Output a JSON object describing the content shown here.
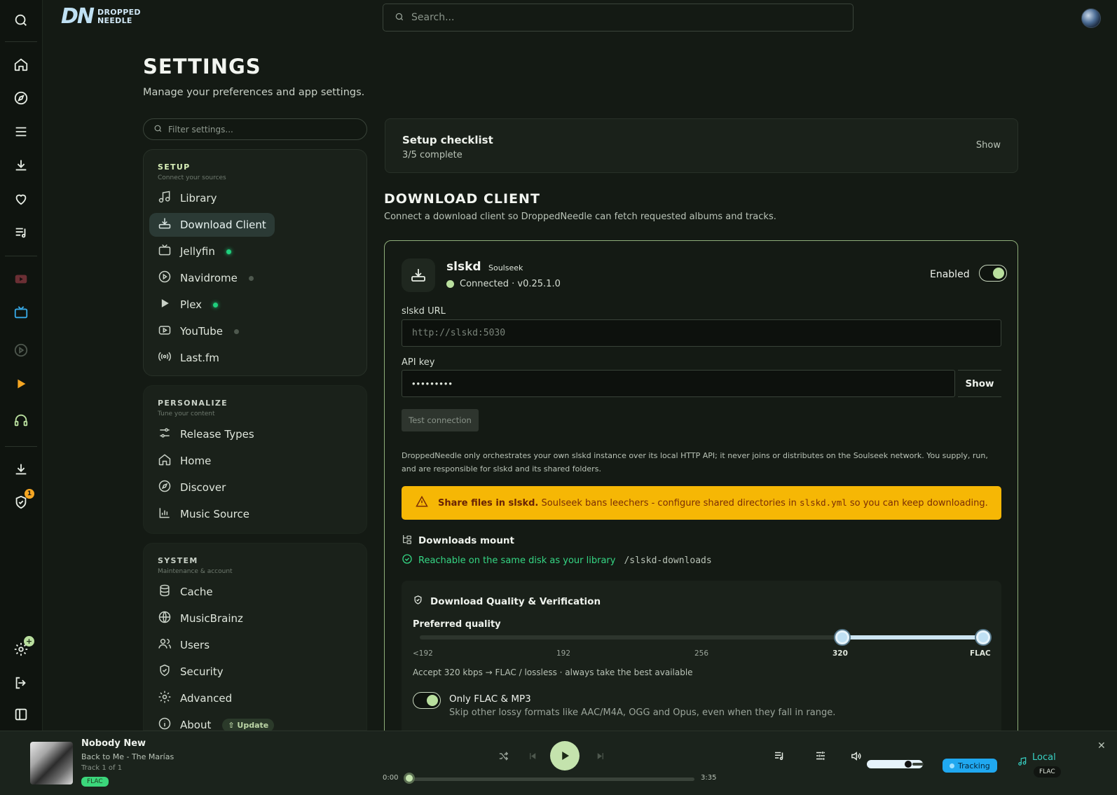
{
  "app": {
    "brand_mark": "DN",
    "brand_line1": "DROPPED",
    "brand_line2": "NEEDLE",
    "search_placeholder": "Search..."
  },
  "rail": {
    "icons": [
      "search-icon",
      "home-icon",
      "compass-icon",
      "menu-icon",
      "download-icon",
      "heart-icon",
      "playlist-icon",
      "youtube-icon",
      "tv-icon",
      "play-circle-icon",
      "play-icon",
      "headphones-icon",
      "download-icon",
      "shield-check-icon",
      "gear-icon",
      "logout-icon",
      "sidebar-icon"
    ],
    "shield_badge": "1",
    "gear_badge": "+"
  },
  "page": {
    "title": "SETTINGS",
    "subtitle": "Manage your preferences and app settings."
  },
  "nav": {
    "filter_placeholder": "Filter settings...",
    "setup": {
      "title": "SETUP",
      "subtitle": "Connect your sources",
      "items": [
        {
          "label": "Library",
          "icon": "music-note-icon"
        },
        {
          "label": "Download Client",
          "icon": "download-tray-icon",
          "active": true
        },
        {
          "label": "Jellyfin",
          "icon": "tv-icon",
          "status": "green"
        },
        {
          "label": "Navidrome",
          "icon": "play-circle-icon",
          "status": "gray"
        },
        {
          "label": "Plex",
          "icon": "play-icon",
          "status": "green"
        },
        {
          "label": "YouTube",
          "icon": "youtube-icon",
          "status": "gray"
        },
        {
          "label": "Last.fm",
          "icon": "broadcast-icon"
        }
      ]
    },
    "personalize": {
      "title": "PERSONALIZE",
      "subtitle": "Tune your content",
      "items": [
        {
          "label": "Release Types",
          "icon": "sliders-icon"
        },
        {
          "label": "Home",
          "icon": "home-icon"
        },
        {
          "label": "Discover",
          "icon": "compass-icon"
        },
        {
          "label": "Music Source",
          "icon": "bar-chart-icon"
        }
      ]
    },
    "system": {
      "title": "SYSTEM",
      "subtitle": "Maintenance & account",
      "items": [
        {
          "label": "Cache",
          "icon": "database-icon"
        },
        {
          "label": "MusicBrainz",
          "icon": "globe-icon"
        },
        {
          "label": "Users",
          "icon": "users-icon"
        },
        {
          "label": "Security",
          "icon": "shield-icon"
        },
        {
          "label": "Advanced",
          "icon": "gear-icon"
        },
        {
          "label": "About",
          "icon": "info-icon",
          "badge": "Update"
        }
      ]
    }
  },
  "checklist": {
    "title": "Setup checklist",
    "progress": "3/5 complete",
    "action": "Show"
  },
  "download_client": {
    "title": "DOWNLOAD CLIENT",
    "subtitle": "Connect a download client so DroppedNeedle can fetch requested albums and tracks.",
    "name": "slskd",
    "tag": "Soulseek",
    "status": "Connected · v0.25.1.0",
    "enabled_label": "Enabled",
    "enabled": true,
    "url_label": "slskd URL",
    "url_placeholder": "http://slskd:5030",
    "api_label": "API key",
    "api_value": "•••••••••",
    "api_show": "Show",
    "test_button": "Test connection",
    "disclaimer": "DroppedNeedle only orchestrates your own slskd instance over its local HTTP API; it never joins or distributes on the Soulseek network. You supply, run, and are responsible for slskd and its shared folders.",
    "warning": {
      "bold": "Share files in slskd.",
      "text_before": " Soulseek bans leechers - configure shared directories in ",
      "code": "slskd.yml",
      "text_after": " so you can keep downloading."
    },
    "mount": {
      "title": "Downloads mount",
      "status": "Reachable on the same disk as your library",
      "path": "/slskd-downloads"
    },
    "quality": {
      "title": "Download Quality & Verification",
      "label": "Preferred quality",
      "ticks": [
        "<192",
        "192",
        "256",
        "320",
        "FLAC"
      ],
      "range_low": "320",
      "range_high": "FLAC",
      "range_fraction": [
        0.75,
        1.0
      ],
      "accept_text": "Accept 320 kbps → FLAC / lossless · always take the best available",
      "only_flac_title": "Only FLAC & MP3",
      "only_flac_sub": "Skip other lossy formats like AAC/M4A, OGG and Opus, even when they fall in range.",
      "only_flac_enabled": true
    }
  },
  "player": {
    "title": "Nobody New",
    "artist": "Back to Me - The Marías",
    "track": "Track 1 of 1",
    "format": "FLAC",
    "elapsed": "0:00",
    "duration": "3:35",
    "progress_fraction": 0.0,
    "volume_fraction": 0.82,
    "tracking": "Tracking",
    "source": "Local",
    "source_format": "FLAC"
  }
}
